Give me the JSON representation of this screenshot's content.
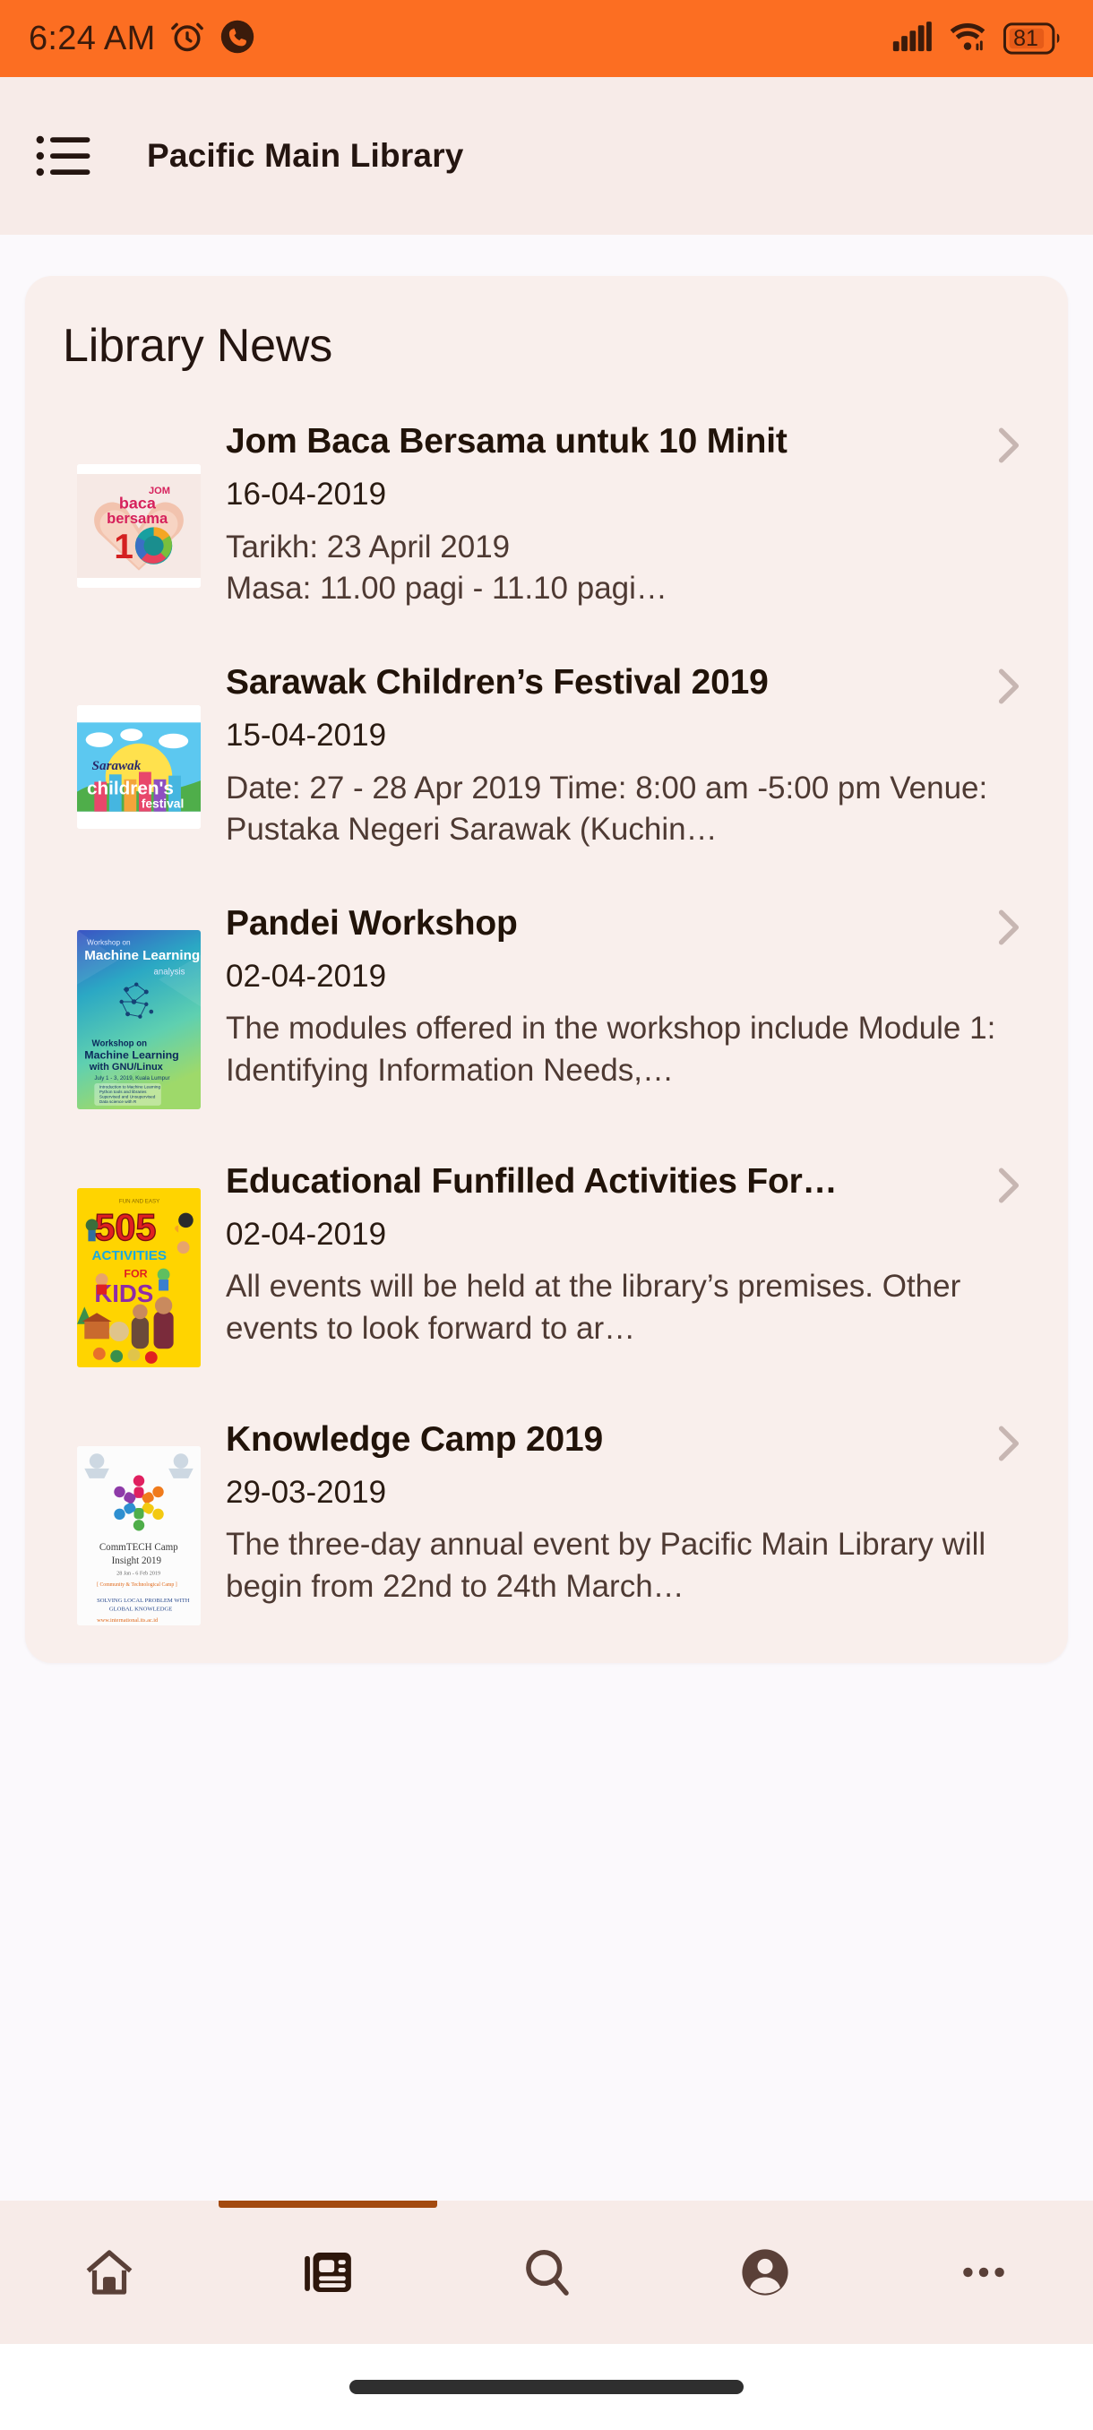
{
  "status_bar": {
    "time": "6:24 AM",
    "battery_level": "81",
    "icons": [
      "alarm-icon",
      "phone-call-icon",
      "signal-bars-icon",
      "wifi-icon",
      "battery-icon"
    ],
    "background_color": "#FC6E22"
  },
  "app_bar": {
    "menu_icon": "list-menu-icon",
    "title": "Pacific Main Library",
    "background_color": "#F7EBE8"
  },
  "card": {
    "heading": "Library News",
    "background_color": "#F9EFEC"
  },
  "news": [
    {
      "title": "Jom Baca Bersama untuk 10 Minit",
      "date": "16-04-2019",
      "description": "Tarikh: 23 April 2019\nMasa: 11.00 pagi - 11.10 pagi…",
      "thumbnail": "jom-baca-bersama-poster",
      "chevron": "chevron-right-icon"
    },
    {
      "title": "Sarawak Children’s Festival 2019",
      "date": "15-04-2019",
      "description": "Date: 27 - 28 Apr 2019 Time: 8:00 am -5:00 pm Venue: Pustaka Negeri Sarawak (Kuchin…",
      "thumbnail": "sarawak-childrens-festival-poster",
      "chevron": "chevron-right-icon"
    },
    {
      "title": "Pandei Workshop",
      "date": "02-04-2019",
      "description": "The modules offered in the workshop include Module 1: Identifying Information Needs,…",
      "thumbnail": "machine-learning-workshop-poster",
      "chevron": "chevron-right-icon"
    },
    {
      "title": "Educational Funfilled Activities For…",
      "date": "02-04-2019",
      "description": "All events will be held at the library’s premises. Other events to look forward to ar…",
      "thumbnail": "505-activities-for-kids-book-cover",
      "chevron": "chevron-right-icon"
    },
    {
      "title": "Knowledge Camp 2019",
      "date": "29-03-2019",
      "description": "The three-day annual event by Pacific Main Library will begin from 22nd to 24th March…",
      "thumbnail": "commtech-camp-insight-poster",
      "chevron": "chevron-right-icon"
    }
  ],
  "bottom_nav": {
    "active_index": 1,
    "indicator_color": "#A34A10",
    "items": [
      {
        "name": "home",
        "icon": "home-icon"
      },
      {
        "name": "news",
        "icon": "newspaper-icon"
      },
      {
        "name": "search",
        "icon": "search-icon"
      },
      {
        "name": "account",
        "icon": "account-circle-icon"
      },
      {
        "name": "more",
        "icon": "more-horizontal-icon"
      }
    ]
  }
}
